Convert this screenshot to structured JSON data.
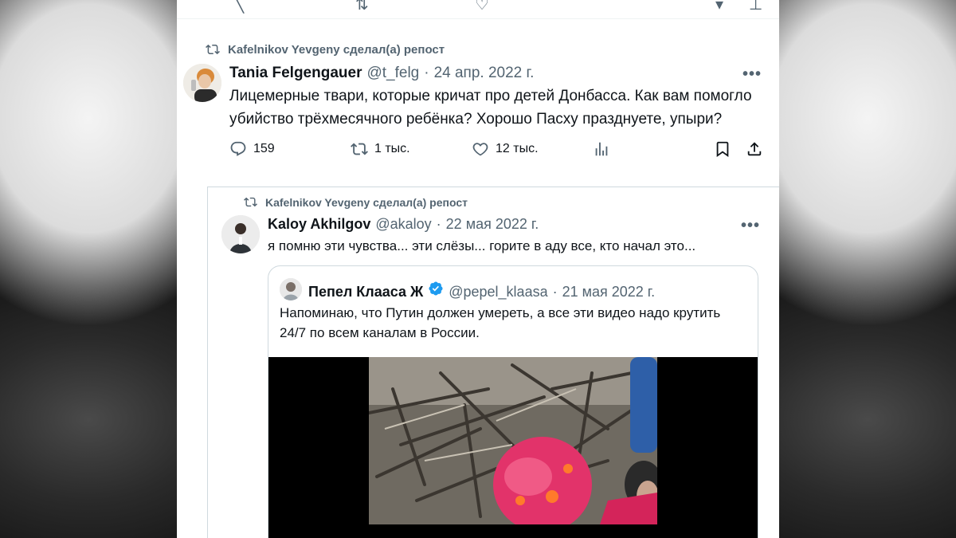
{
  "retweet1": {
    "label": "Kafelnikov Yevgeny сделал(а) репост"
  },
  "tweet1": {
    "name": "Tania Felgengauer",
    "handle": "@t_felg",
    "separator": "·",
    "date": "24 апр. 2022 г.",
    "text_line1": "Лицемерные твари, которые кричат про детей Донбасса. Как вам помогло",
    "text_line2": "убийство трёхмесячного ребёнка? Хорошо Пасху празднуете, упыри?",
    "replies": "159",
    "reposts": "1 тыс.",
    "likes": "12 тыс.",
    "more": "•••"
  },
  "retweet2": {
    "label": "Kafelnikov Yevgeny сделал(а) репост"
  },
  "tweet2": {
    "name": "Kaloy Akhilgov",
    "handle": "@akaloy",
    "separator": "·",
    "date": "22 мая 2022 г.",
    "text": "я помню эти чувства... эти слёзы... горите в аду все, кто начал это...",
    "more": "•••"
  },
  "quoted": {
    "name": "Пепел Клааса Ж",
    "handle": "@pepel_klaasa",
    "separator": "·",
    "date": "21 мая 2022 г.",
    "text_line1": "Напоминаю, что Путин должен умереть, а все эти видео надо крутить",
    "text_line2": "24/7 по всем каналам в России."
  },
  "icons": {
    "repost": "repost-icon",
    "reply": "reply-icon",
    "like": "heart-icon",
    "views": "analytics-icon",
    "bookmark": "bookmark-icon",
    "share": "share-icon",
    "verified": "verified-badge-icon"
  },
  "colors": {
    "text": "#0f1419",
    "muted": "#536471",
    "border": "#cfd9de",
    "verified": "#1d9bf0"
  }
}
